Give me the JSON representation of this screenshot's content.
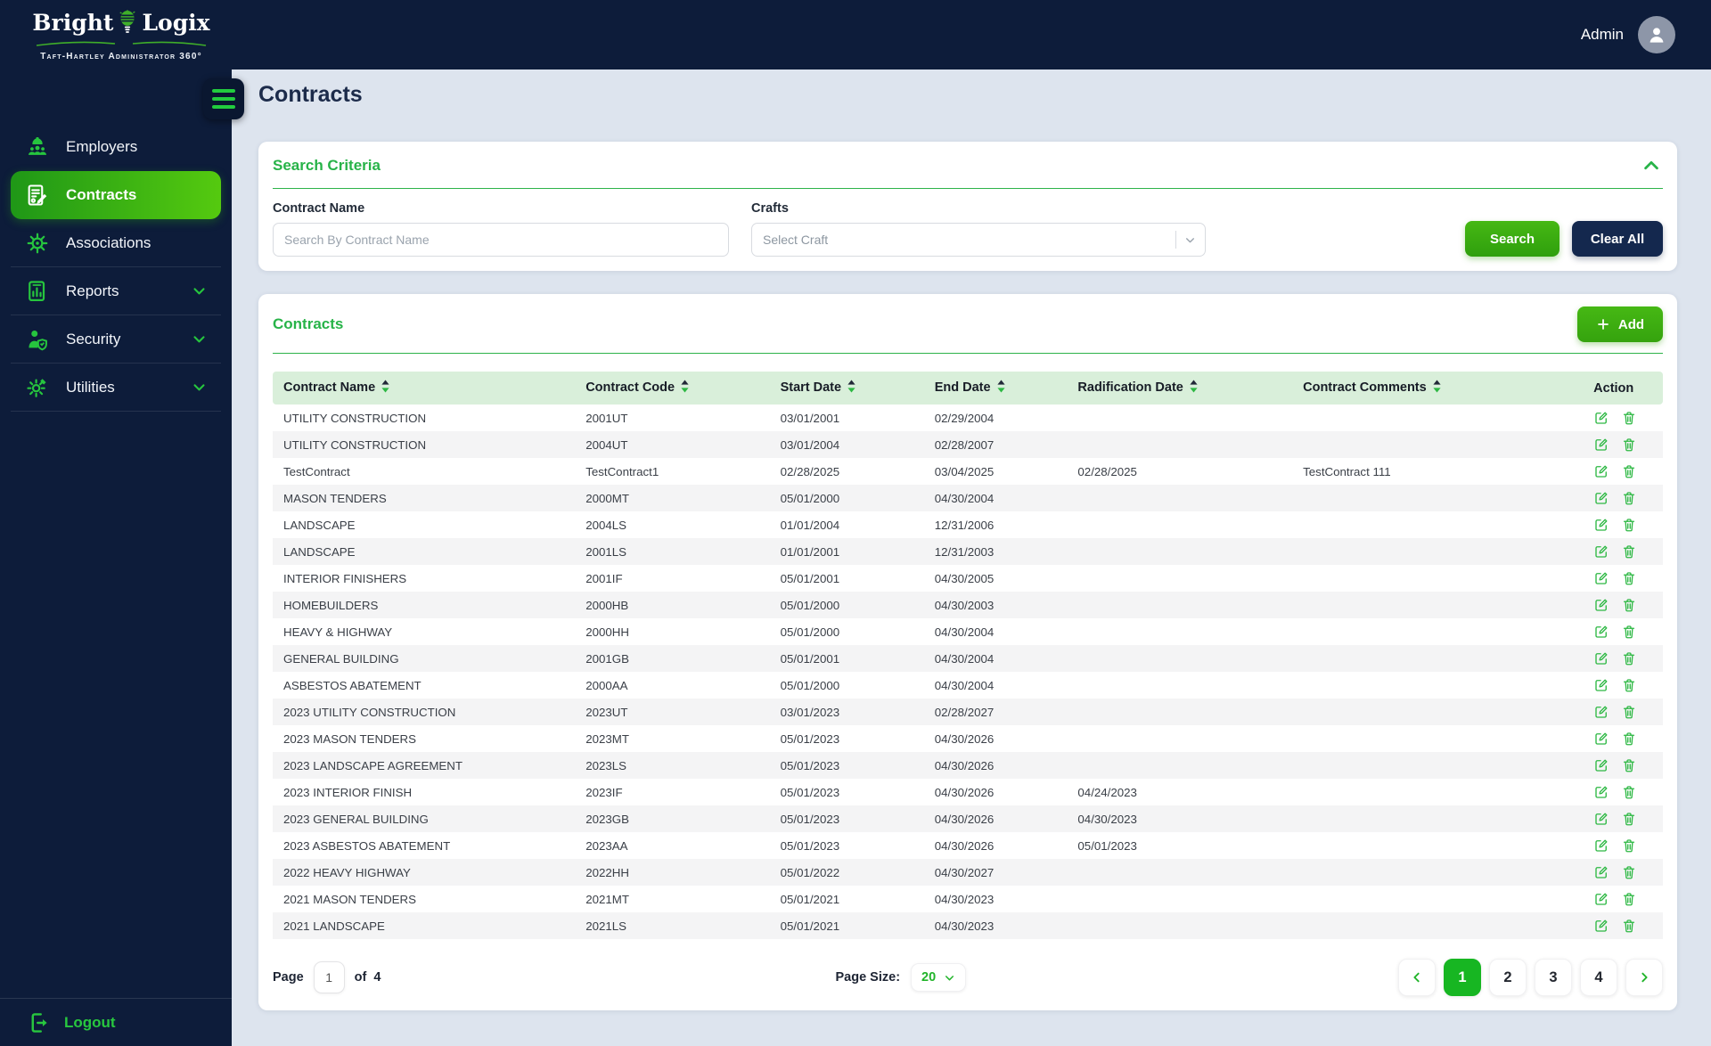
{
  "colors": {
    "navy": "#0d1c3a",
    "accent_green": "#2db843",
    "active_nav_gradient": [
      "#1f9717",
      "#55ca0f"
    ],
    "table_header_bg": "#d9efda",
    "page_bg": "#dde4ee",
    "pagination_active": "#17b622"
  },
  "brand": {
    "name_first": "Bright",
    "name_second": "Logix",
    "tagline": "Taft-Hartley Administrator 360°"
  },
  "topbar": {
    "user_label": "Admin"
  },
  "sidebar": {
    "items": [
      {
        "id": "employers",
        "label": "Employers",
        "icon": "employers-icon",
        "active": false,
        "chevron": false
      },
      {
        "id": "contracts",
        "label": "Contracts",
        "icon": "contracts-icon",
        "active": true,
        "chevron": false
      },
      {
        "id": "associations",
        "label": "Associations",
        "icon": "associations-icon",
        "active": false,
        "chevron": false
      },
      {
        "id": "reports",
        "label": "Reports",
        "icon": "reports-icon",
        "active": false,
        "chevron": true
      },
      {
        "id": "security",
        "label": "Security",
        "icon": "security-icon",
        "active": false,
        "chevron": true
      },
      {
        "id": "utilities",
        "label": "Utilities",
        "icon": "utilities-icon",
        "active": false,
        "chevron": true
      }
    ],
    "logout_label": "Logout"
  },
  "page": {
    "title": "Contracts"
  },
  "search_panel": {
    "title": "Search Criteria",
    "contract_name_label": "Contract Name",
    "contract_name_placeholder": "Search By Contract Name",
    "contract_name_value": "",
    "crafts_label": "Crafts",
    "crafts_placeholder": "Select Craft",
    "search_button_label": "Search",
    "clear_button_label": "Clear All"
  },
  "contracts_panel": {
    "title": "Contracts",
    "add_button_label": "Add",
    "table": {
      "columns": [
        {
          "id": "contract-name",
          "label": "Contract Name",
          "sortable": true
        },
        {
          "id": "contract-code",
          "label": "Contract Code",
          "sortable": true
        },
        {
          "id": "start-date",
          "label": "Start Date",
          "sortable": true
        },
        {
          "id": "end-date",
          "label": "End Date",
          "sortable": true
        },
        {
          "id": "radification-date",
          "label": "Radification Date",
          "sortable": true
        },
        {
          "id": "contract-comments",
          "label": "Contract Comments",
          "sortable": true
        },
        {
          "id": "action",
          "label": "Action",
          "sortable": false
        }
      ],
      "rows": [
        {
          "contract_name": "UTILITY CONSTRUCTION",
          "contract_code": "2001UT",
          "start_date": "03/01/2001",
          "end_date": "02/29/2004",
          "radification_date": "",
          "contract_comments": ""
        },
        {
          "contract_name": "UTILITY CONSTRUCTION",
          "contract_code": "2004UT",
          "start_date": "03/01/2004",
          "end_date": "02/28/2007",
          "radification_date": "",
          "contract_comments": ""
        },
        {
          "contract_name": "TestContract",
          "contract_code": "TestContract1",
          "start_date": "02/28/2025",
          "end_date": "03/04/2025",
          "radification_date": "02/28/2025",
          "contract_comments": "TestContract 111"
        },
        {
          "contract_name": "MASON TENDERS",
          "contract_code": "2000MT",
          "start_date": "05/01/2000",
          "end_date": "04/30/2004",
          "radification_date": "",
          "contract_comments": ""
        },
        {
          "contract_name": "LANDSCAPE",
          "contract_code": "2004LS",
          "start_date": "01/01/2004",
          "end_date": "12/31/2006",
          "radification_date": "",
          "contract_comments": ""
        },
        {
          "contract_name": "LANDSCAPE",
          "contract_code": "2001LS",
          "start_date": "01/01/2001",
          "end_date": "12/31/2003",
          "radification_date": "",
          "contract_comments": ""
        },
        {
          "contract_name": "INTERIOR FINISHERS",
          "contract_code": "2001IF",
          "start_date": "05/01/2001",
          "end_date": "04/30/2005",
          "radification_date": "",
          "contract_comments": ""
        },
        {
          "contract_name": "HOMEBUILDERS",
          "contract_code": "2000HB",
          "start_date": "05/01/2000",
          "end_date": "04/30/2003",
          "radification_date": "",
          "contract_comments": ""
        },
        {
          "contract_name": "HEAVY & HIGHWAY",
          "contract_code": "2000HH",
          "start_date": "05/01/2000",
          "end_date": "04/30/2004",
          "radification_date": "",
          "contract_comments": ""
        },
        {
          "contract_name": "GENERAL BUILDING",
          "contract_code": "2001GB",
          "start_date": "05/01/2001",
          "end_date": "04/30/2004",
          "radification_date": "",
          "contract_comments": ""
        },
        {
          "contract_name": "ASBESTOS ABATEMENT",
          "contract_code": "2000AA",
          "start_date": "05/01/2000",
          "end_date": "04/30/2004",
          "radification_date": "",
          "contract_comments": ""
        },
        {
          "contract_name": "2023 UTILITY CONSTRUCTION",
          "contract_code": "2023UT",
          "start_date": "03/01/2023",
          "end_date": "02/28/2027",
          "radification_date": "",
          "contract_comments": ""
        },
        {
          "contract_name": "2023 MASON TENDERS",
          "contract_code": "2023MT",
          "start_date": "05/01/2023",
          "end_date": "04/30/2026",
          "radification_date": "",
          "contract_comments": ""
        },
        {
          "contract_name": "2023 LANDSCAPE AGREEMENT",
          "contract_code": "2023LS",
          "start_date": "05/01/2023",
          "end_date": "04/30/2026",
          "radification_date": "",
          "contract_comments": ""
        },
        {
          "contract_name": "2023 INTERIOR FINISH",
          "contract_code": "2023IF",
          "start_date": "05/01/2023",
          "end_date": "04/30/2026",
          "radification_date": "04/24/2023",
          "contract_comments": ""
        },
        {
          "contract_name": "2023 GENERAL BUILDING",
          "contract_code": "2023GB",
          "start_date": "05/01/2023",
          "end_date": "04/30/2026",
          "radification_date": "04/30/2023",
          "contract_comments": ""
        },
        {
          "contract_name": "2023 ASBESTOS ABATEMENT",
          "contract_code": "2023AA",
          "start_date": "05/01/2023",
          "end_date": "04/30/2026",
          "radification_date": "05/01/2023",
          "contract_comments": ""
        },
        {
          "contract_name": "2022 HEAVY HIGHWAY",
          "contract_code": "2022HH",
          "start_date": "05/01/2022",
          "end_date": "04/30/2027",
          "radification_date": "",
          "contract_comments": ""
        },
        {
          "contract_name": "2021 MASON TENDERS",
          "contract_code": "2021MT",
          "start_date": "05/01/2021",
          "end_date": "04/30/2023",
          "radification_date": "",
          "contract_comments": ""
        },
        {
          "contract_name": "2021 LANDSCAPE",
          "contract_code": "2021LS",
          "start_date": "05/01/2021",
          "end_date": "04/30/2023",
          "radification_date": "",
          "contract_comments": ""
        }
      ]
    },
    "pagination": {
      "page_label": "Page",
      "current_page": "1",
      "of_label": "of",
      "total_pages": "4",
      "page_size_label": "Page Size:",
      "page_size_value": "20",
      "pages": [
        "1",
        "2",
        "3",
        "4"
      ],
      "active_page": "1"
    }
  }
}
